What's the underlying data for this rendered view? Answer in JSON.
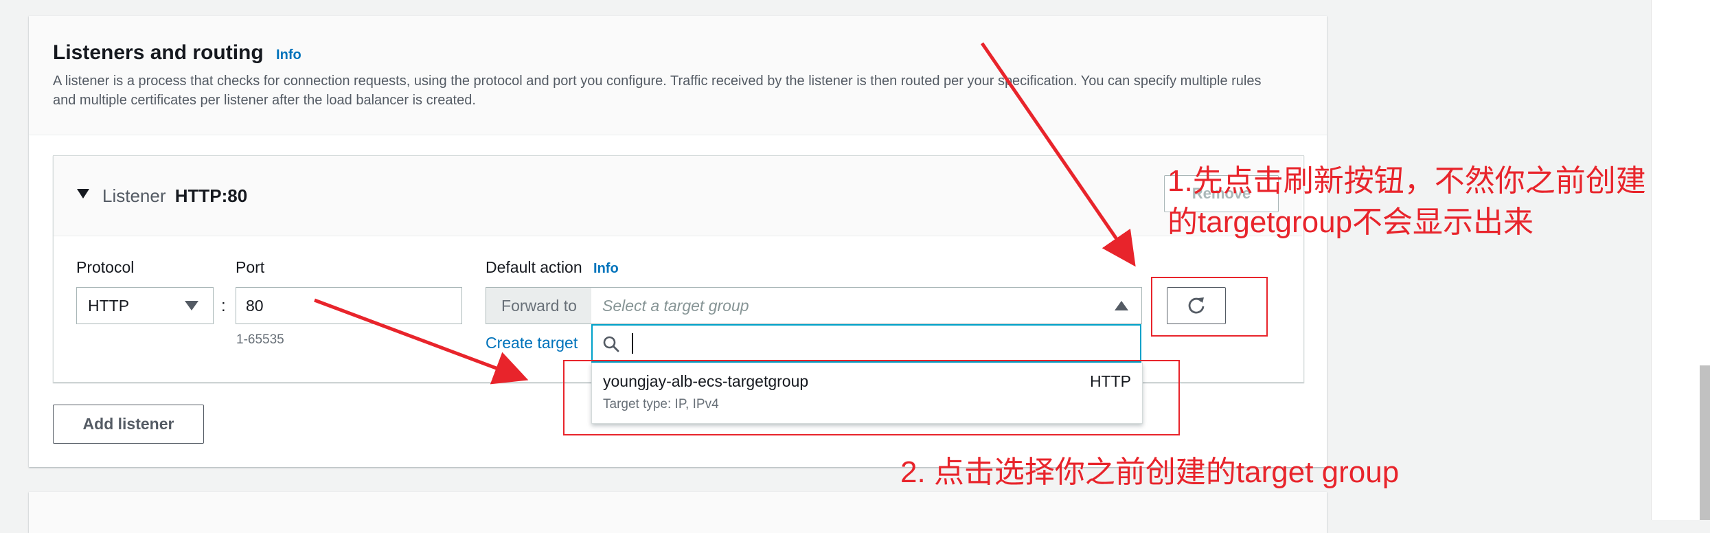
{
  "section": {
    "title": "Listeners and routing",
    "info": "Info",
    "description": "A listener is a process that checks for connection requests, using the protocol and port you configure. Traffic received by the listener is then routed per your specification. You can specify multiple rules and multiple certificates per listener after the load balancer is created."
  },
  "listener": {
    "label": "Listener",
    "name": "HTTP:80",
    "remove_label": "Remove"
  },
  "protocol": {
    "label": "Protocol",
    "value": "HTTP"
  },
  "port": {
    "label": "Port",
    "value": "80",
    "hint": "1-65535"
  },
  "default_action": {
    "label": "Default action",
    "info": "Info",
    "forward_label": "Forward to",
    "placeholder": "Select a target group",
    "create_link": "Create target",
    "search_value": ""
  },
  "dropdown": {
    "options": [
      {
        "name": "youngjay-alb-ecs-targetgroup",
        "protocol": "HTTP",
        "subtitle": "Target type: IP, IPv4"
      }
    ]
  },
  "add_listener_label": "Add listener",
  "annotations": {
    "step1_line1": "1.先点击刷新按钮，不然你之前创建",
    "step1_line2": "的targetgroup不会显示出来",
    "step2": "2. 点击选择你之前创建的target group"
  },
  "colors": {
    "annotation_red": "#e8242b",
    "link_blue": "#0073bb",
    "focus_cyan": "#00a1c9"
  },
  "icons": {
    "expand": "caret-down-icon",
    "select": "caret-down-icon",
    "open": "caret-up-icon",
    "search": "search-icon",
    "refresh": "refresh-icon"
  }
}
